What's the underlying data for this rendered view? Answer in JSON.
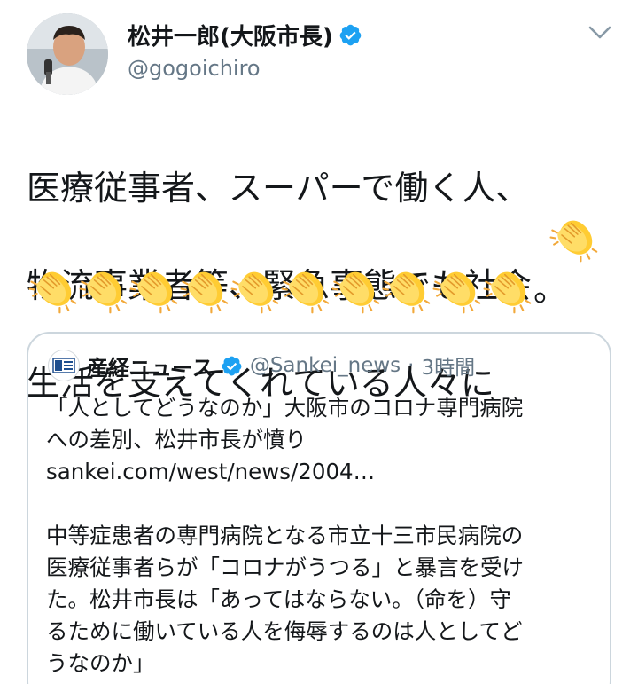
{
  "author": {
    "display_name": "松井一郎(大阪市長)",
    "handle": "@gogoichiro",
    "verified": true,
    "avatar_icon": "profile-photo"
  },
  "menu": {
    "icon": "chevron-down-icon"
  },
  "tweet": {
    "lines": [
      "医療従事者、スーパーで働く人、",
      "物流事業者等、緊急事態でも社会",
      "生活を支えてくれている人々に"
    ],
    "emoji": "clapping-hands",
    "emoji_count": 11,
    "ending": "。"
  },
  "quote": {
    "logo_icon": "sankei-logo-icon",
    "name": "産経ニュース",
    "verified": true,
    "handle": "@Sankei_news",
    "separator": "·",
    "time": "3時間",
    "headline_lines": [
      "「人としてどうなのか」大阪市のコロナ専門病院",
      "への差別、松井市長が憤り"
    ],
    "link": "sankei.com/west/news/2004…",
    "body_lines": [
      "中等症患者の専門病院となる市立十三市民病院の",
      "医療従事者らが「コロナがうつる」と暴言を受け",
      "た。松井市長は「あってはならない。（命を）守",
      "るために働いている人を侮辱するのは人としてど",
      "うなのか」"
    ]
  },
  "colors": {
    "text": "#14171a",
    "secondary": "#657786",
    "verified_blue": "#1da1f2",
    "border": "#ccd6dd",
    "clap_yellow": "#ffcc33"
  }
}
